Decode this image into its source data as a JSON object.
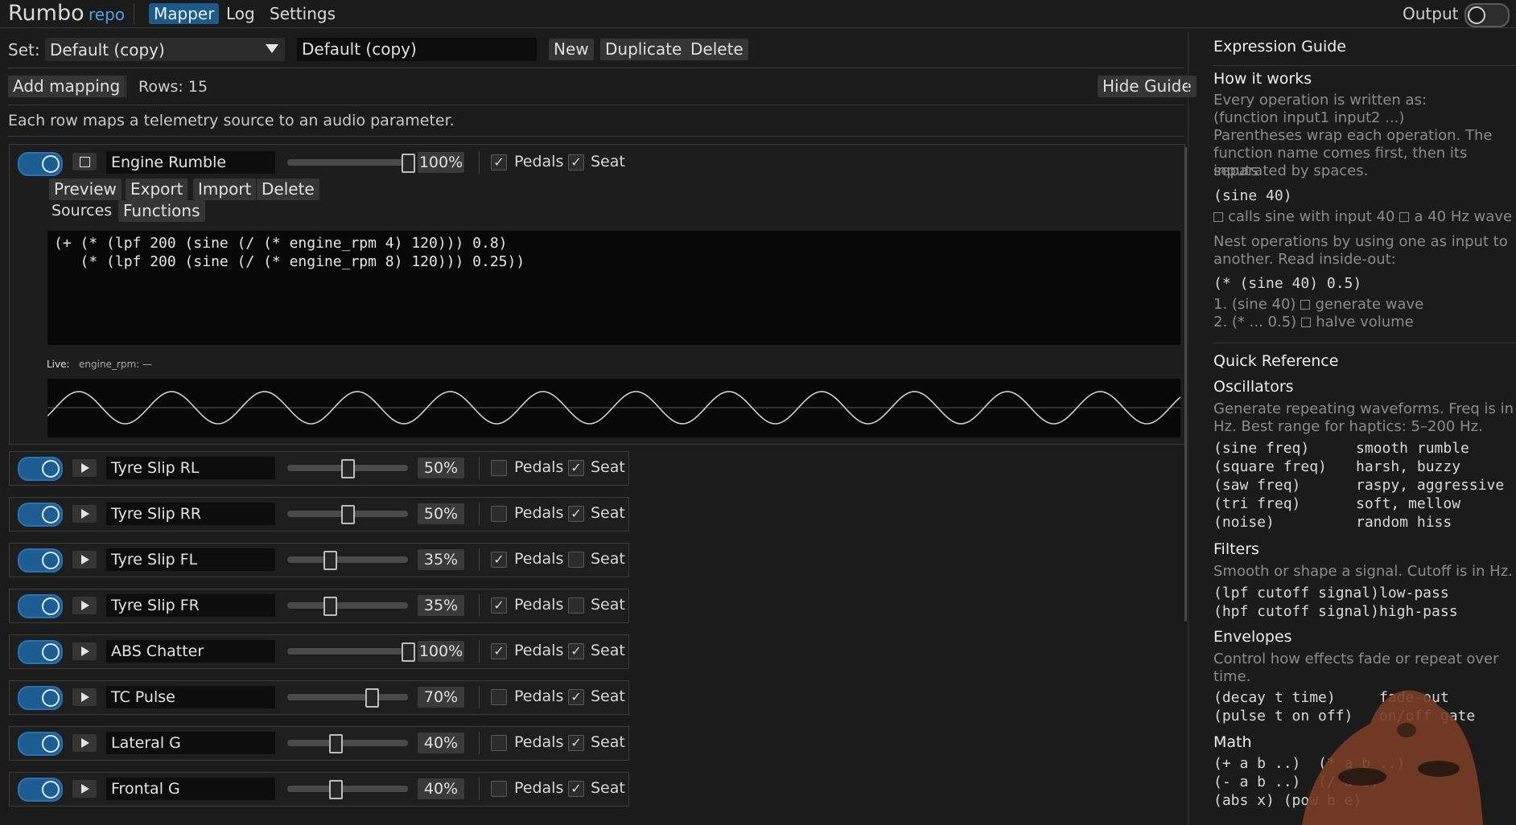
{
  "app": {
    "title": "Rumbo",
    "repo_link": "repo"
  },
  "nav": {
    "tabs": [
      "Mapper",
      "Log",
      "Settings"
    ],
    "active": "Mapper"
  },
  "output": {
    "label": "Output",
    "enabled": false
  },
  "set_bar": {
    "label": "Set:",
    "selected": "Default (copy)",
    "name_value": "Default (copy)",
    "new_label": "New",
    "duplicate_label": "Duplicate",
    "delete_label": "Delete"
  },
  "toolbar": {
    "add_mapping_label": "Add mapping",
    "rows_text": "Rows: 15",
    "hide_guide_label": "Hide Guide"
  },
  "hint": "Each row maps a telemetry source to an audio parameter.",
  "expanded": {
    "name": "Engine Rumble",
    "volume": 1.0,
    "volume_text": "100%",
    "pedals_label": "Pedals",
    "pedals": true,
    "seat_label": "Seat",
    "seat": true,
    "actions": [
      "Preview",
      "Export",
      "Import",
      "Delete"
    ],
    "tabs": [
      "Sources",
      "Functions"
    ],
    "expression_line1": "(+ (* (lpf 200 (sine (/ (* engine_rpm 4) 120))) 0.8)",
    "expression_line2": "   (* (lpf 200 (sine (/ (* engine_rpm 8) 120))) 0.25))",
    "live_label": "Live:",
    "live_value": "engine_rpm: —"
  },
  "mappings": [
    {
      "name": "Tyre Slip RL",
      "volume": 0.5,
      "volume_text": "50%",
      "pedals": false,
      "seat": true
    },
    {
      "name": "Tyre Slip RR",
      "volume": 0.5,
      "volume_text": "50%",
      "pedals": false,
      "seat": true
    },
    {
      "name": "Tyre Slip FL",
      "volume": 0.35,
      "volume_text": "35%",
      "pedals": true,
      "seat": false
    },
    {
      "name": "Tyre Slip FR",
      "volume": 0.35,
      "volume_text": "35%",
      "pedals": true,
      "seat": false
    },
    {
      "name": "ABS Chatter",
      "volume": 1.0,
      "volume_text": "100%",
      "pedals": true,
      "seat": true
    },
    {
      "name": "TC Pulse",
      "volume": 0.7,
      "volume_text": "70%",
      "pedals": false,
      "seat": true
    },
    {
      "name": "Lateral G",
      "volume": 0.4,
      "volume_text": "40%",
      "pedals": false,
      "seat": true
    },
    {
      "name": "Frontal G",
      "volume": 0.4,
      "volume_text": "40%",
      "pedals": false,
      "seat": true
    }
  ],
  "checkbox_labels": {
    "pedals": "Pedals",
    "seat": "Seat"
  },
  "guide": {
    "title": "Expression Guide",
    "how_title": "How it works",
    "how_p1a": "Every operation is written as:",
    "how_p1b": "(function input1 input2 ...)",
    "how_p1c": "Parentheses wrap each operation. The",
    "how_p1d": "function name comes first, then its inputs",
    "how_p1e": "separated by spaces.",
    "ex1": "(sine 40)",
    "ex1_note_a": "calls sine with input 40",
    "ex1_note_b": "a 40 Hz wave",
    "nest_a": "Nest operations by using one as input to",
    "nest_b": "another. Read inside-out:",
    "ex2": "(* (sine 40) 0.5)",
    "step1_a": "1. (sine 40)",
    "step1_b": "generate wave",
    "step2_a": "2. (* ... 0.5)",
    "step2_b": "halve volume",
    "qr_title": "Quick Reference",
    "osc_title": "Oscillators",
    "osc_desc_a": "Generate repeating waveforms. Freq is in",
    "osc_desc_b": "Hz. Best range for haptics: 5–200 Hz.",
    "oscillators": [
      {
        "code": "(sine freq)",
        "desc": "smooth rumble"
      },
      {
        "code": "(square freq)",
        "desc": "harsh, buzzy"
      },
      {
        "code": "(saw freq)",
        "desc": "raspy, aggressive"
      },
      {
        "code": "(tri freq)",
        "desc": "soft, mellow"
      },
      {
        "code": "(noise)",
        "desc": "random hiss"
      }
    ],
    "filters_title": "Filters",
    "filters_desc": "Smooth or shape a signal. Cutoff is in Hz.",
    "filters": [
      {
        "code": "(lpf cutoff signal)",
        "desc": "low-pass"
      },
      {
        "code": "(hpf cutoff signal)",
        "desc": "high-pass"
      }
    ],
    "env_title": "Envelopes",
    "env_desc_a": "Control how effects fade or repeat over",
    "env_desc_b": "time.",
    "envelopes": [
      {
        "code": "(decay t time)",
        "desc": "fade-out"
      },
      {
        "code": "(pulse t on off)",
        "desc": "on/off gate"
      }
    ],
    "math_title": "Math",
    "math_lines": [
      "(+ a b ..)  (* a b ..)",
      "(- a b ..)  (/ a b)",
      "(abs x) (pow b e)"
    ]
  }
}
